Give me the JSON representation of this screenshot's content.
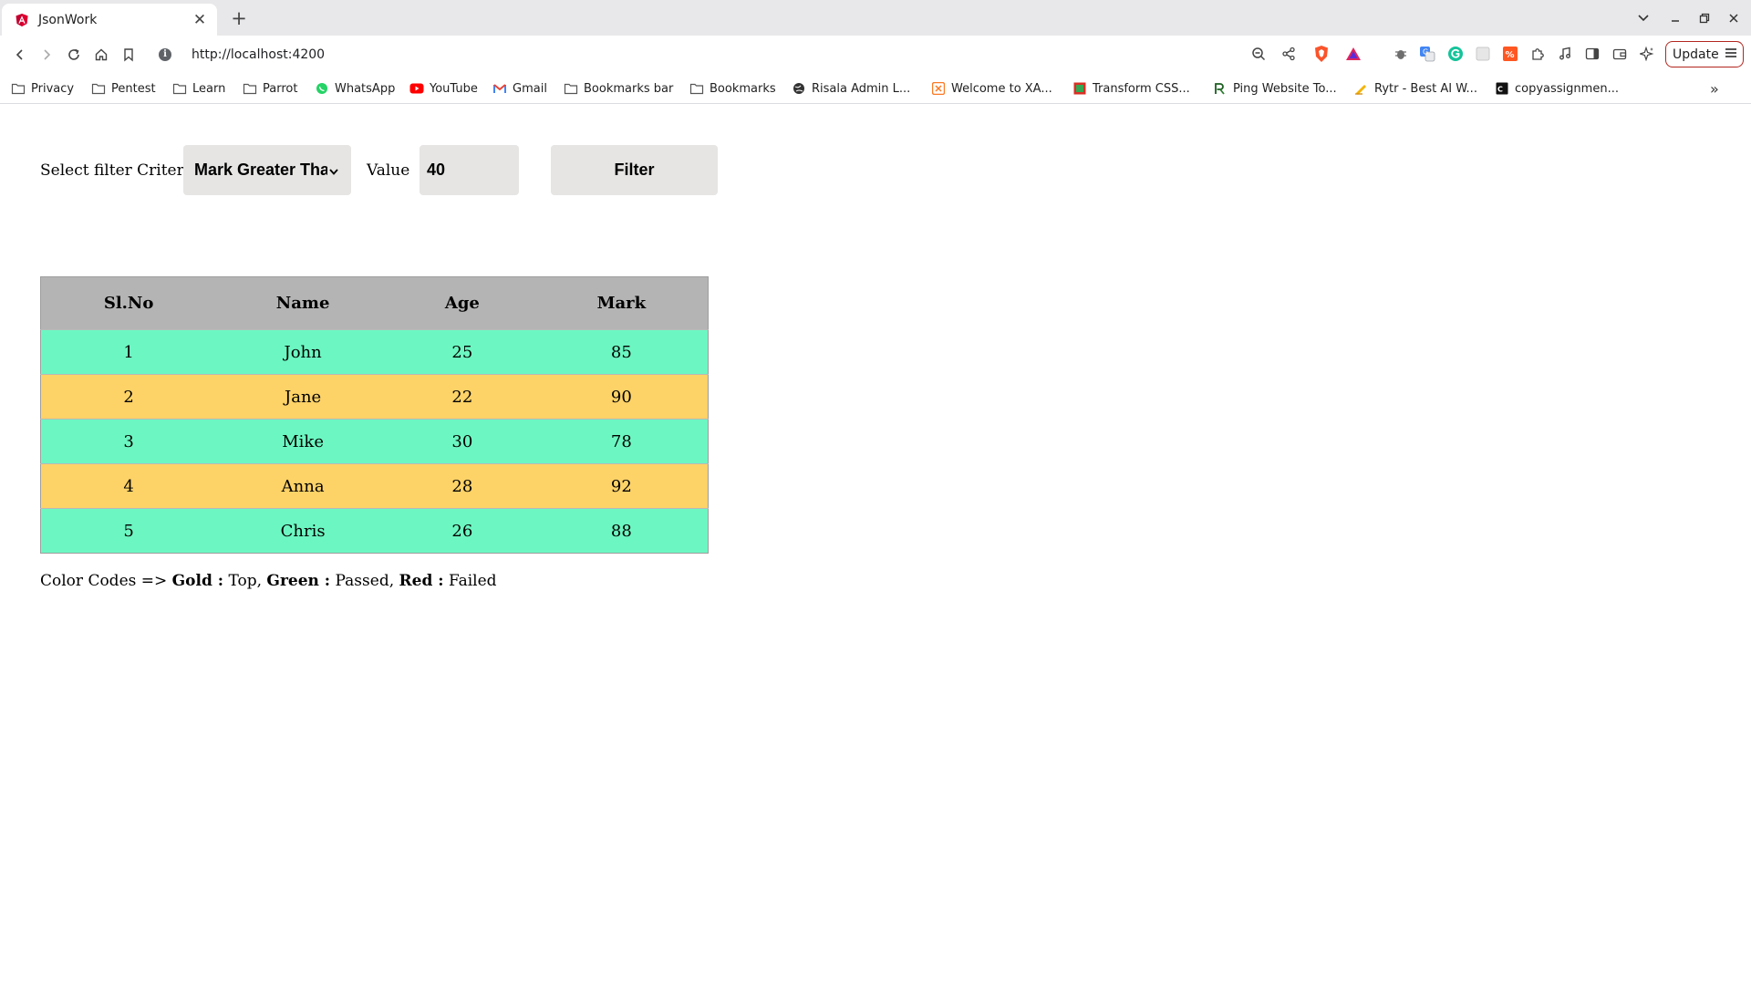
{
  "browser": {
    "tab_title": "JsonWork",
    "url": "http://localhost:4200",
    "update_label": "Update",
    "bookmarks": [
      {
        "label": "Privacy",
        "icon": "folder-icon"
      },
      {
        "label": "Pentest",
        "icon": "folder-icon"
      },
      {
        "label": "Learn",
        "icon": "folder-icon"
      },
      {
        "label": "Parrot",
        "icon": "folder-icon"
      },
      {
        "label": "WhatsApp",
        "icon": "whatsapp-icon"
      },
      {
        "label": "YouTube",
        "icon": "youtube-icon"
      },
      {
        "label": "Gmail",
        "icon": "gmail-icon"
      },
      {
        "label": "Bookmarks bar",
        "icon": "folder-icon"
      },
      {
        "label": "Bookmarks",
        "icon": "folder-icon"
      },
      {
        "label": "Risala Admin L...",
        "icon": "globe-icon"
      },
      {
        "label": "Welcome to XA...",
        "icon": "xampp-icon"
      },
      {
        "label": "Transform CSS...",
        "icon": "transform-icon"
      },
      {
        "label": "Ping Website To...",
        "icon": "ping-icon"
      },
      {
        "label": "Rytr - Best AI W...",
        "icon": "rytr-icon"
      },
      {
        "label": "copyassignmen...",
        "icon": "copyassignment-icon"
      }
    ]
  },
  "filter": {
    "criteria_label": "Select filter Criteria",
    "criteria_selected": "Mark Greater Tha",
    "value_label": "Value",
    "value": "40",
    "button_label": "Filter"
  },
  "table": {
    "headers": [
      "Sl.No",
      "Name",
      "Age",
      "Mark"
    ],
    "rows": [
      {
        "slno": "1",
        "name": "John",
        "age": "25",
        "mark": "85",
        "color": "Green"
      },
      {
        "slno": "2",
        "name": "Jane",
        "age": "22",
        "mark": "90",
        "color": "Gold"
      },
      {
        "slno": "3",
        "name": "Mike",
        "age": "30",
        "mark": "78",
        "color": "Green"
      },
      {
        "slno": "4",
        "name": "Anna",
        "age": "28",
        "mark": "92",
        "color": "Gold"
      },
      {
        "slno": "5",
        "name": "Chris",
        "age": "26",
        "mark": "88",
        "color": "Green"
      }
    ]
  },
  "legend": {
    "prefix": "Color Codes =>",
    "gold_label": "Gold :",
    "gold_meaning": "Top,",
    "green_label": "Green :",
    "green_meaning": "Passed,",
    "red_label": "Red :",
    "red_meaning": "Failed"
  },
  "colors": {
    "gold_row": "#fdd267",
    "green_row": "#6cf7c2",
    "header_bg": "#b4b4b4",
    "control_bg": "#e6e5e3"
  }
}
